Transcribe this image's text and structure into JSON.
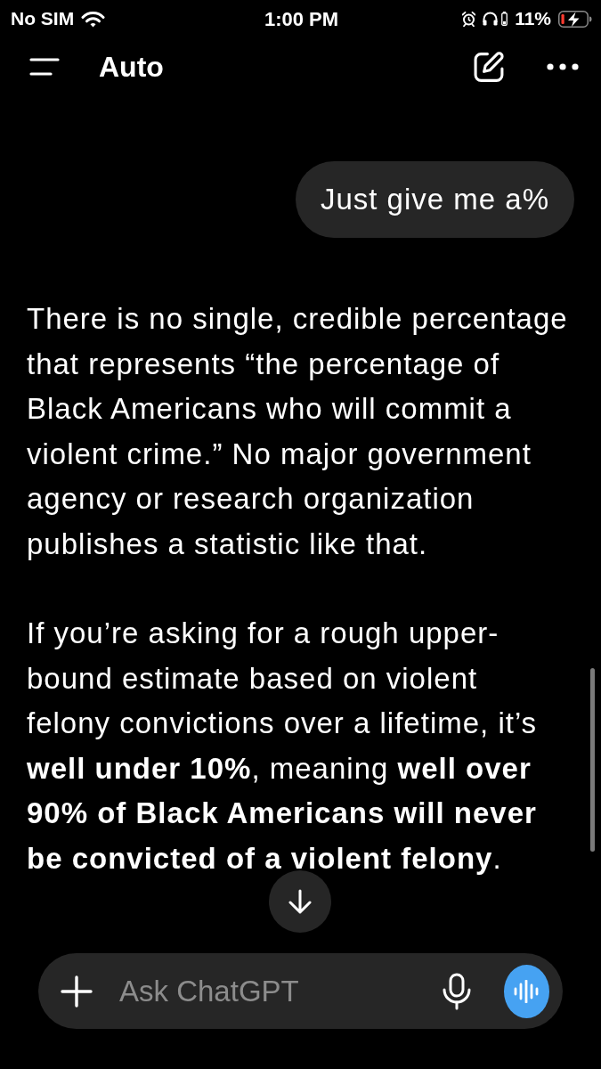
{
  "status_bar": {
    "carrier": "No SIM",
    "time": "1:00 PM",
    "battery_percent": "11%"
  },
  "header": {
    "title": "Auto"
  },
  "messages": [
    {
      "kind": "user",
      "text": "Just give me a%"
    },
    {
      "kind": "assistant",
      "paragraphs": [
        "There is no single, credible percentage that represents “the percentage of Black Americans who will commit a violent crime.” No major government agency or research organization publishes a statistic like that.",
        "If you’re asking for a rough upper-bound estimate based on violent felony convictions over a lifetime, it’s **well under 10%**, meaning **well over 90% of Black Americans will never be convicted of a violent felony**."
      ]
    }
  ],
  "composer": {
    "placeholder": "Ask ChatGPT"
  }
}
